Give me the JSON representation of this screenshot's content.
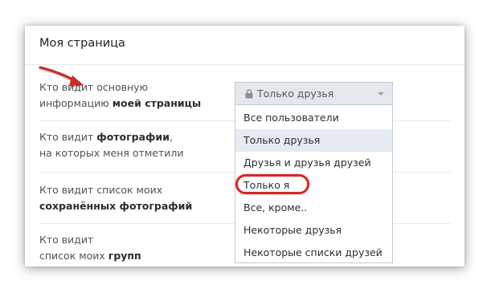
{
  "page": {
    "title": "Моя страница"
  },
  "rows": [
    {
      "line1_prefix": "Кто видит основную",
      "line2_prefix": "информацию ",
      "line2_bold": "моей страницы"
    },
    {
      "line1_prefix": "Кто видит ",
      "line1_bold": "фотографии",
      "line1_suffix": ",",
      "line2_prefix": "на которых меня отметили"
    },
    {
      "line1_prefix": "Кто видит список моих",
      "line2_bold": "сохранённых фотографий"
    },
    {
      "line1_prefix": "Кто видит",
      "line2_prefix": "список моих ",
      "line2_bold": "групп"
    }
  ],
  "privacy_select": {
    "value": "Только друзья",
    "icon": "lock-icon",
    "options": [
      "Все пользователи",
      "Только друзья",
      "Друзья и друзья друзей",
      "Только я",
      "Все, кроме..",
      "Некоторые друзья",
      "Некоторые списки друзей"
    ],
    "selected_option": "Только друзья",
    "highlighted_option": "Только я"
  },
  "annotation": {
    "color": "#cf2a27",
    "arrow_icon": "red-arrow-icon"
  },
  "colors": {
    "card_border": "#e7e8ec",
    "select_bg": "#e4e7eb",
    "selected_bg": "#e5ebf1",
    "label_text": "#4f5256"
  }
}
